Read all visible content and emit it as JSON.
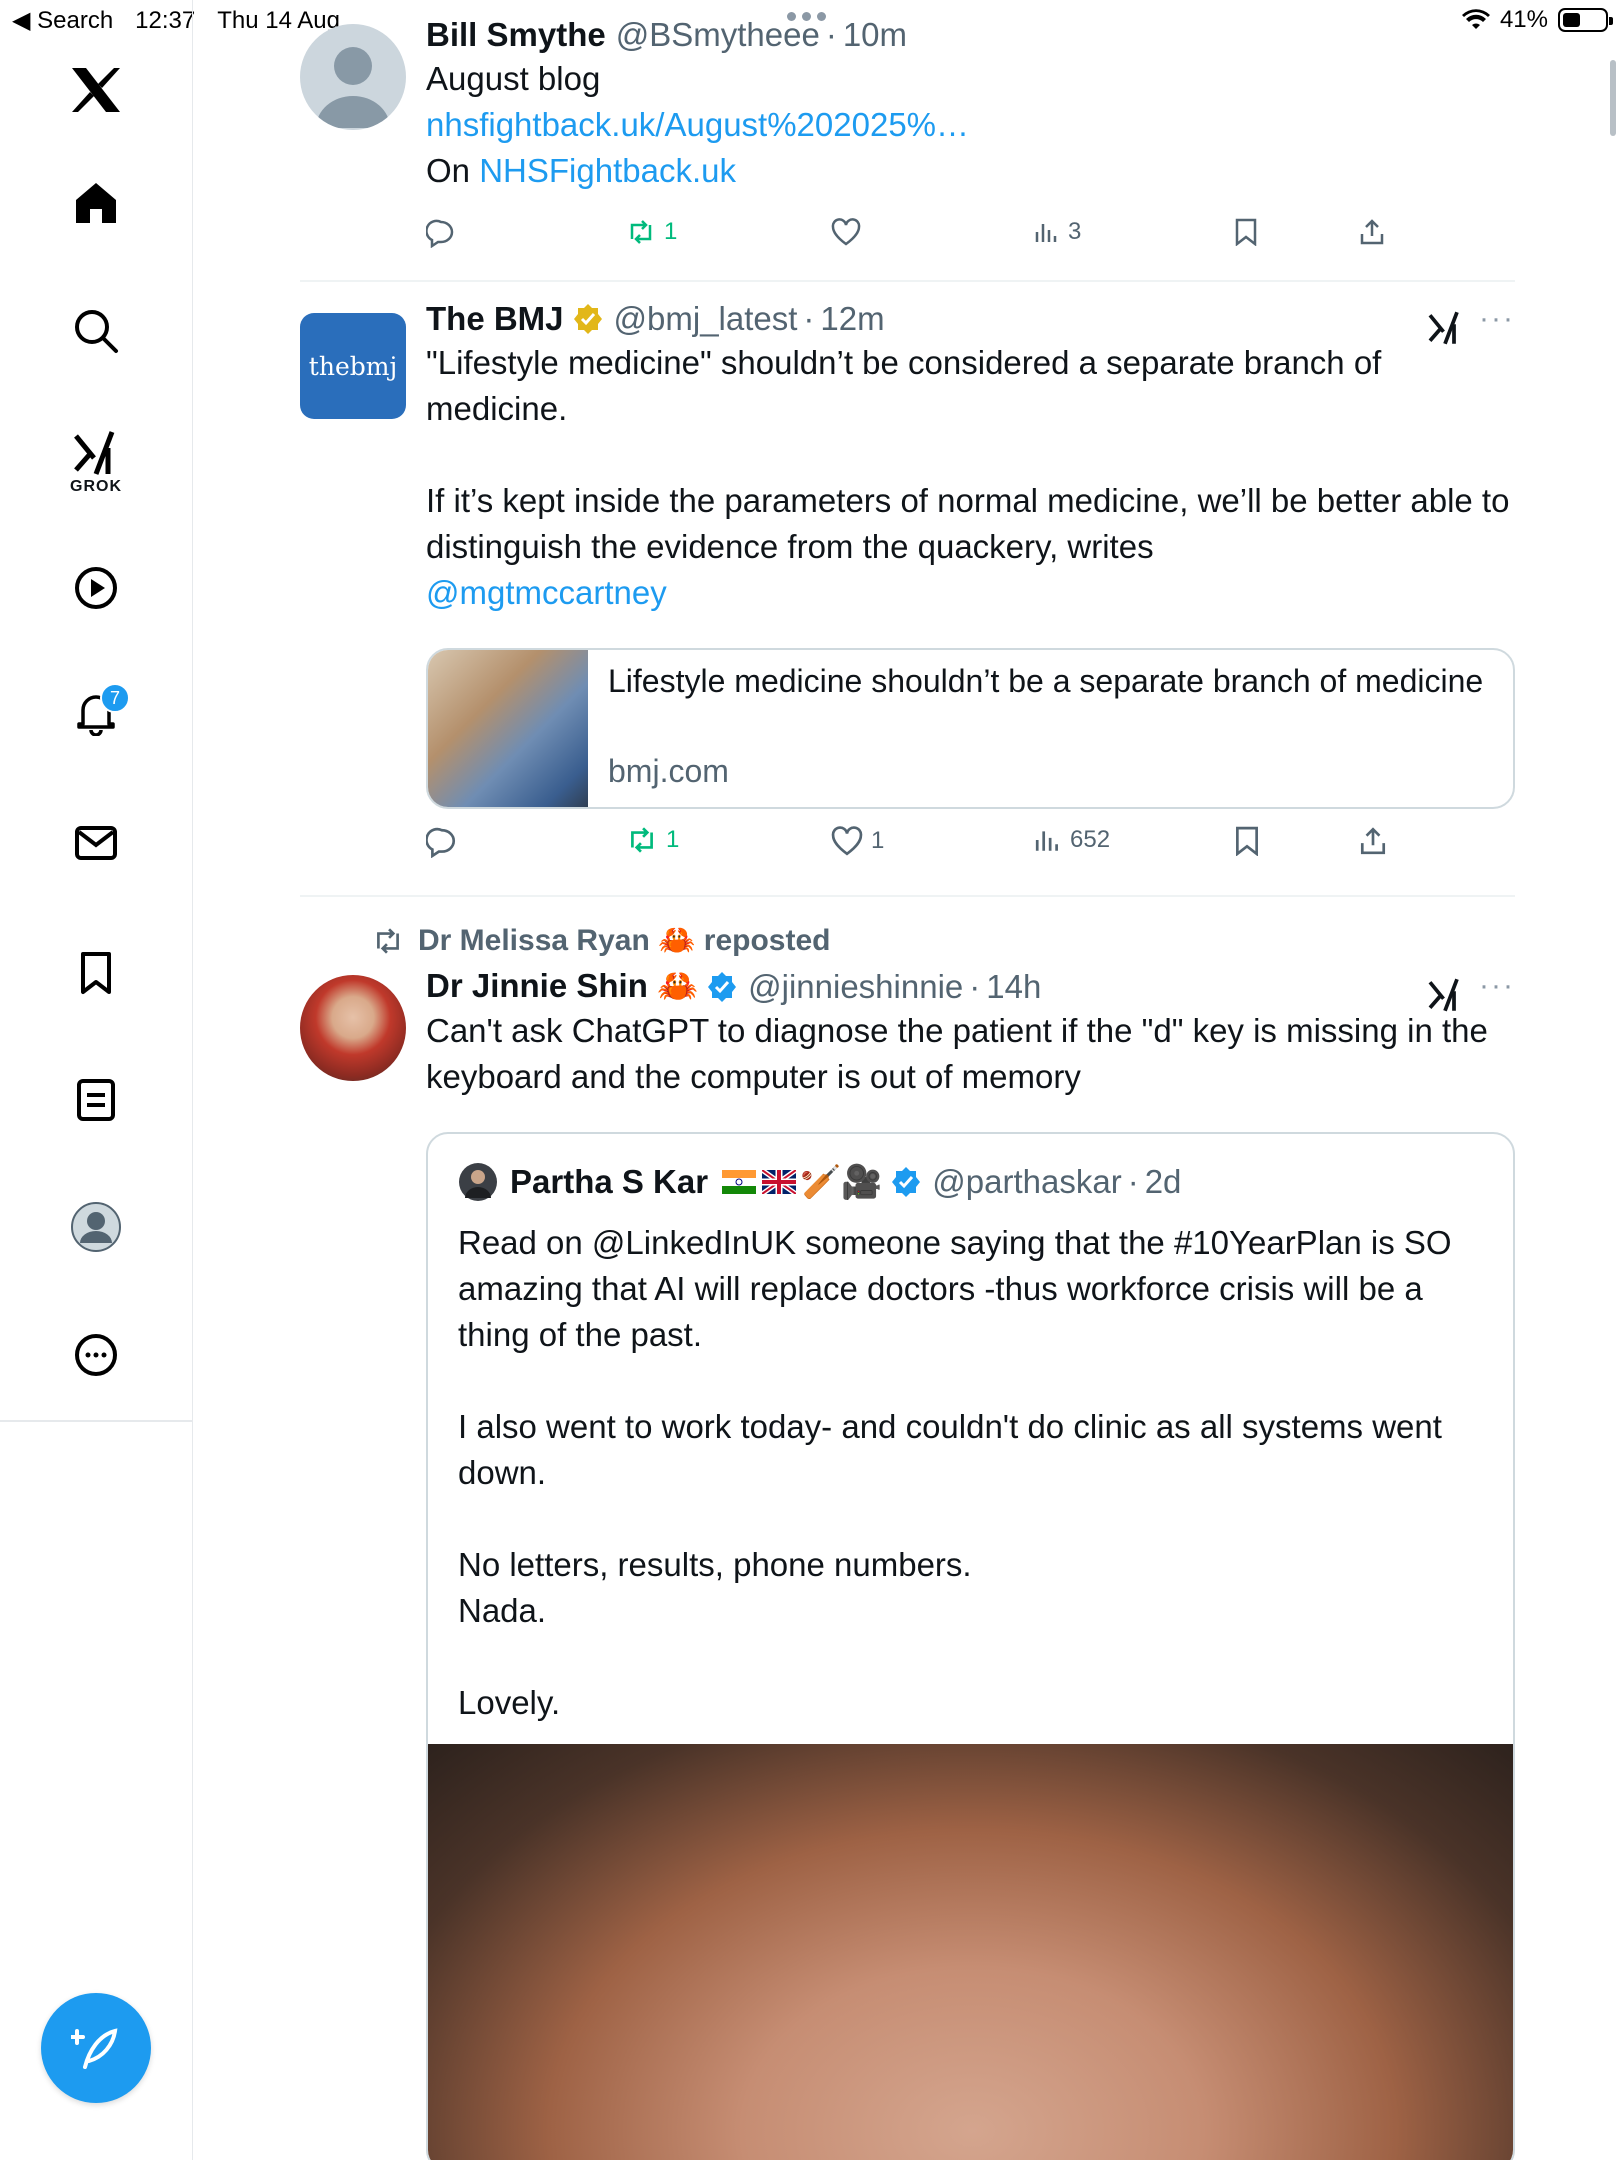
{
  "status_bar": {
    "back_label": "◀ Search",
    "time": "12:37",
    "date": "Thu 14 Aug",
    "battery": "41%"
  },
  "sidebar": {
    "grok_label": "GROK",
    "notifications_count": "7"
  },
  "posts": [
    {
      "name": "Bill Smythe",
      "handle": "@BSmytheee",
      "time": "10m",
      "line1": "August blog",
      "link": "nhsfightback.uk/August%202025%…",
      "line3_prefix": "On ",
      "line3_link": "NHSFightback.uk",
      "reposts": "1",
      "views": "3"
    },
    {
      "name": "The BMJ",
      "handle": "@bmj_latest",
      "time": "12m",
      "avatar_text": "thebmj",
      "text": "\"Lifestyle medicine\" shouldn’t be considered a separate branch of medicine.\n\nIf it’s kept inside the parameters of normal medicine, we’ll be better able to distinguish the evidence from the quackery, writes",
      "mention": "@mgtmccartney",
      "card_title": "Lifestyle medicine shouldn’t be a separate branch of medicine",
      "card_domain": "bmj.com",
      "reposts": "1",
      "likes": "1",
      "views": "652"
    },
    {
      "reposted_by": "Dr Melissa Ryan 🦀 reposted",
      "name": "Dr Jinnie Shin 🦀",
      "handle": "@jinnieshinnie",
      "time": "14h",
      "text": "Can't ask ChatGPT to diagnose the patient if the \"d\" key is missing in the keyboard and the computer is out of memory",
      "quote": {
        "name": "Partha S Kar",
        "emoji": "🏏🎥",
        "handle": "@parthaskar",
        "time": "2d",
        "text": "Read on @LinkedInUK someone saying that the #10YearPlan is SO amazing that AI will replace doctors -thus workforce crisis will be a thing of the past.\n\nI also went to work today- and couldn't do clinic as all systems went down.\n\nNo letters, results, phone numbers.\nNada.\n\nLovely."
      }
    }
  ],
  "colors": {
    "accent": "#1d9bf0",
    "repost_green": "#00ba7c",
    "secondary_text": "#536471",
    "bmj_blue": "#2a6ebb",
    "verified_gold": "#e2b719"
  },
  "icons": [
    "x-logo-icon",
    "home-icon",
    "search-icon",
    "grok-icon",
    "video-icon",
    "bell-icon",
    "mail-icon",
    "bookmark-icon",
    "lists-icon",
    "profile-icon",
    "more-icon",
    "compose-icon",
    "reply-icon",
    "repost-icon",
    "like-icon",
    "views-icon",
    "share-icon",
    "more-dots-icon",
    "verified-icon"
  ]
}
